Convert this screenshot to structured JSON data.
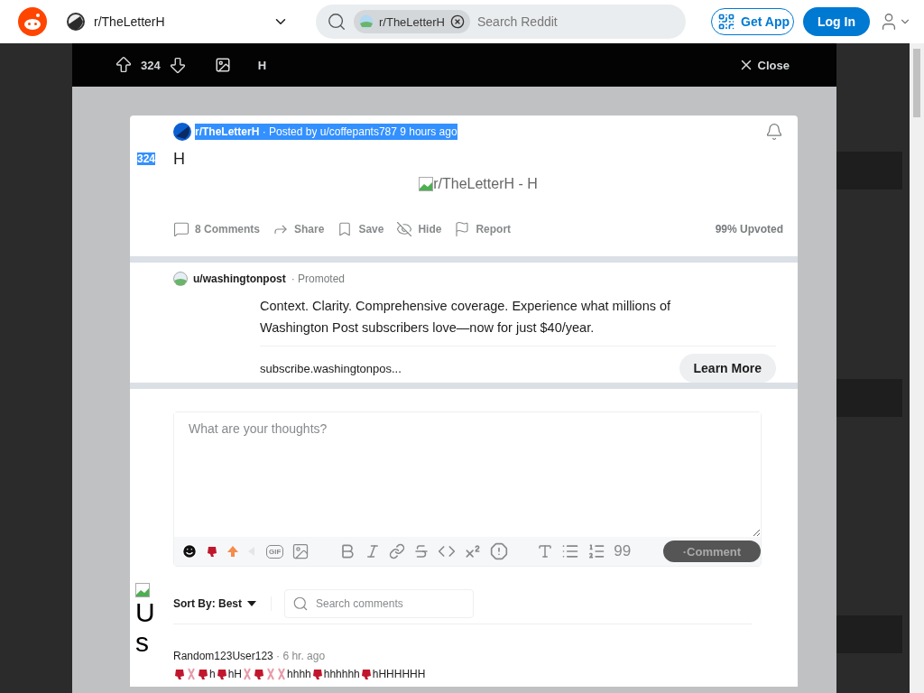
{
  "header": {
    "community": "r/TheLetterH",
    "search": {
      "chip": "r/TheLetterH",
      "placeholder": "Search Reddit"
    },
    "get_app": "Get App",
    "login": "Log In"
  },
  "modal_bar": {
    "score": "324",
    "title": "H",
    "close": "Close"
  },
  "post": {
    "score": {
      "text": "324",
      "highlighted": true
    },
    "meta": [
      {
        "text": "r/TheLetterH",
        "kind": "community",
        "highlighted": true
      },
      {
        "text": "·",
        "kind": "dot",
        "highlighted": true
      },
      {
        "text": "Posted by",
        "kind": "plain",
        "highlighted": true
      },
      {
        "text": "u/coffepants787",
        "kind": "user",
        "highlighted": true
      },
      {
        "text": "9 hours ago",
        "kind": "plain",
        "highlighted": true
      }
    ],
    "title": "H",
    "image_alt": "r/TheLetterH - H",
    "actions": [
      {
        "label": "8 Comments",
        "kind": "comments"
      },
      {
        "label": "Share",
        "kind": "share"
      },
      {
        "label": "Save",
        "kind": "save"
      },
      {
        "label": "Hide",
        "kind": "hide"
      },
      {
        "label": "Report",
        "kind": "report"
      }
    ],
    "upvoted": "99% Upvoted"
  },
  "ad": {
    "user": "u/washingtonpost",
    "tag": "· Promoted",
    "text": "Context. Clarity. Comprehensive coverage. Experience what millions of Washington Post subscribers love—now for just $40/year.",
    "link": "subscribe.washingtonpos...",
    "button": "Learn More"
  },
  "composer": {
    "placeholder": "What are your thoughts?",
    "gif": "GIF",
    "quote": "99",
    "submit": "·Comment"
  },
  "side_alt": "Us",
  "sort": {
    "label": "Sort By: Best",
    "search_placeholder": "Search comments"
  },
  "comments": [
    {
      "author": "Random123User123",
      "time": "· 6 hr. ago",
      "body": [
        {
          "kind": "creature"
        },
        {
          "kind": "bunny"
        },
        {
          "kind": "creature"
        },
        {
          "kind": "text",
          "text": "h"
        },
        {
          "kind": "creature"
        },
        {
          "kind": "text",
          "text": "hH"
        },
        {
          "kind": "bunny"
        },
        {
          "kind": "creature"
        },
        {
          "kind": "bunny"
        },
        {
          "kind": "bunny"
        },
        {
          "kind": "text",
          "text": "hhhh"
        },
        {
          "kind": "creature"
        },
        {
          "kind": "text",
          "text": "hhhhhh"
        },
        {
          "kind": "creature"
        },
        {
          "kind": "text",
          "text": "hHHHHHH"
        }
      ]
    }
  ]
}
